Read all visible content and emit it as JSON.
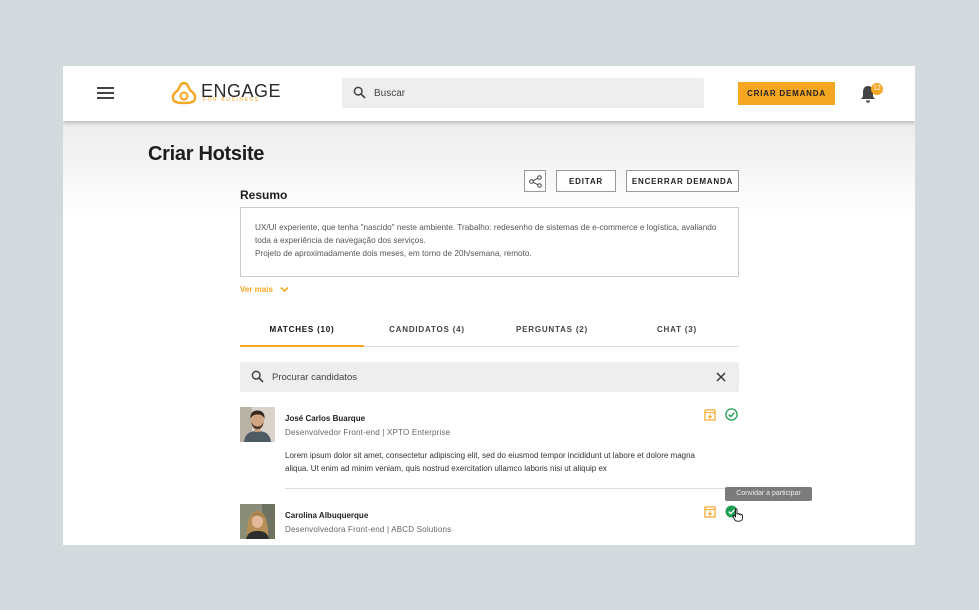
{
  "header": {
    "logo_text": "ENGAGE",
    "logo_subtitle": "FOR BUSINESS",
    "search_placeholder": "Buscar",
    "create_label": "CRIAR DEMANDA",
    "notifications_count": "12"
  },
  "page": {
    "title": "Criar Hotsite",
    "share_icon": "share-icon",
    "edit_label": "EDITAR",
    "close_label": "ENCERRAR DEMANDA"
  },
  "summary": {
    "title": "Resumo",
    "lines": [
      "UX/UI experiente, que tenha \"nascido\" neste ambiente. Trabalho: redesenho de sistemas de e-commerce e logística, avaliando",
      "toda a experiência de navegação dos serviços.",
      "Projeto de aproximadamente dois meses, em torno de 20h/semana, remoto."
    ],
    "see_more": "Ver mais"
  },
  "tabs": [
    {
      "label": "MATCHES (10)",
      "active": true
    },
    {
      "label": "CANDIDATOS (4)",
      "active": false
    },
    {
      "label": "PERGUNTAS (2)",
      "active": false
    },
    {
      "label": "CHAT (3)",
      "active": false
    }
  ],
  "candidate_search": {
    "placeholder": "Procurar candidatos"
  },
  "candidates": [
    {
      "name": "José Carlos Buarque",
      "role": "Desenvolvedor Front-end  |  XPTO Enterprise",
      "description": [
        "Lorem ipsum dolor sit amet, consectetur adipiscing elit, sed do eiusmod tempor incididunt ut labore et dolore magna",
        "aliqua. Ut enim ad minim veniam, quis nostrud exercitation ullamco laboris nisi ut aliquip ex"
      ]
    },
    {
      "name": "Carolina Albuquerque",
      "role": "Desenvolvedora Front-end  |  ABCD Solutions"
    }
  ],
  "tooltip": "Convidar a participar",
  "colors": {
    "accent": "#f5a623",
    "check": "#1e9e52",
    "background": "#d3dadd"
  }
}
